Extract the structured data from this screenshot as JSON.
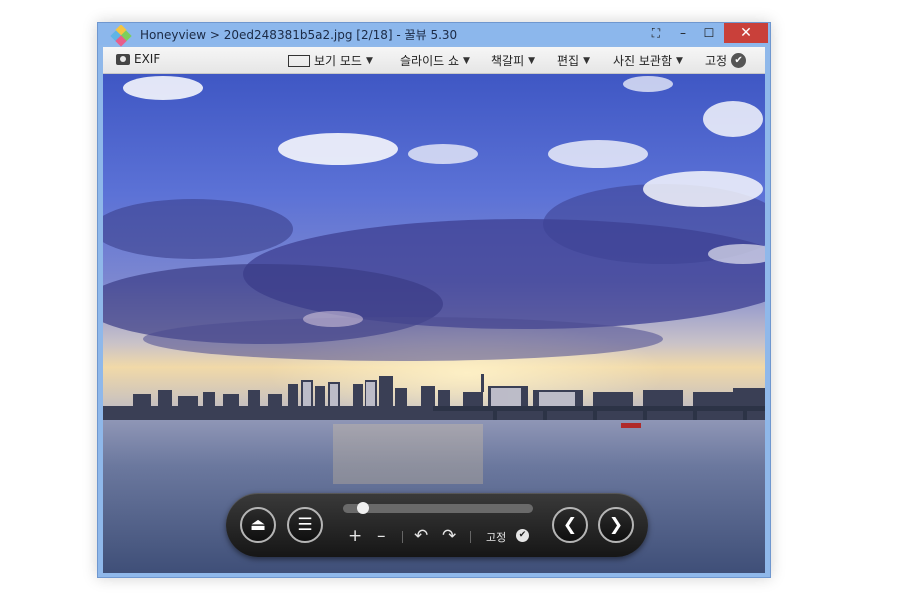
{
  "window": {
    "title": "Honeyview > 20ed248381b5a2.jpg [2/18] - 꿀뷰 5.30",
    "minimize": "–",
    "maximize": "☐",
    "close": "✕",
    "capture": "⛶"
  },
  "toolbar": {
    "exif": "EXIF",
    "view_mode": "보기 모드",
    "slideshow": "슬라이드 쇼",
    "bookmark": "책갈피",
    "edit": "편집",
    "photo_storage": "사진 보관함",
    "pin": "고정",
    "caret": "▼",
    "check": "✔"
  },
  "controls": {
    "eject": "⏏",
    "menu": "☰",
    "zoom_in": "+",
    "zoom_out": "–",
    "rotate_left": "↶",
    "rotate_right": "↷",
    "pin": "고정",
    "check": "✔",
    "prev": "❮",
    "next": "❯",
    "slider_position": 0.08
  },
  "colors": {
    "titlebar": "#8cb7ec",
    "close": "#c9403a",
    "sky_top": "#4a63c9",
    "water": "#5d6f96"
  }
}
